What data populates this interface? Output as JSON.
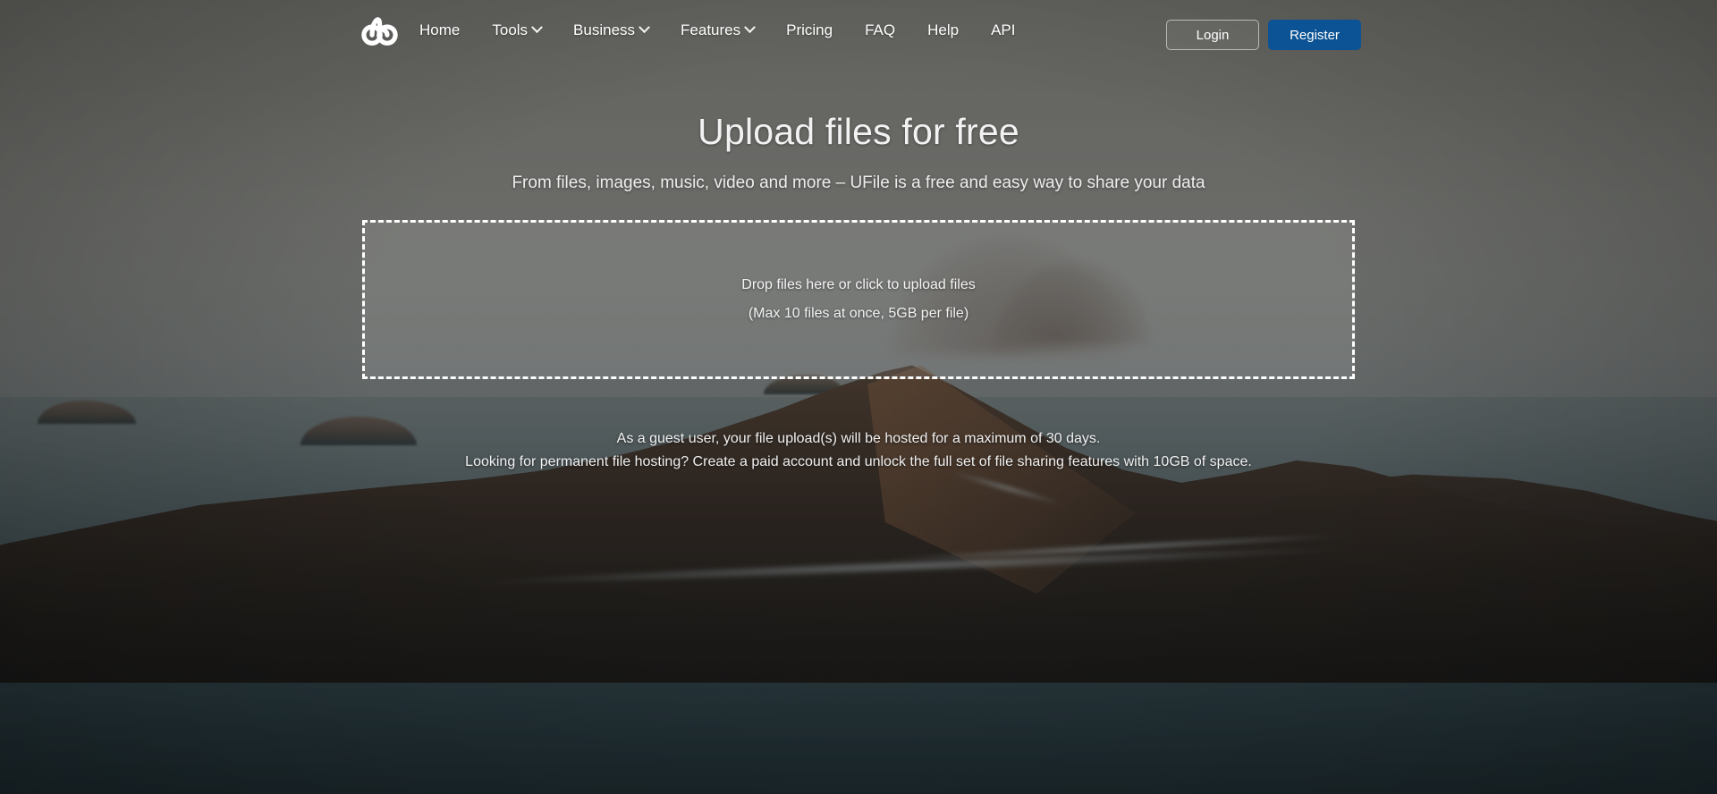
{
  "brand": {
    "logo_icon": "ufile-trefoil-logo-icon",
    "name": "UFile"
  },
  "nav": {
    "items": [
      {
        "label": "Home",
        "has_dropdown": false
      },
      {
        "label": "Tools",
        "has_dropdown": true
      },
      {
        "label": "Business",
        "has_dropdown": true
      },
      {
        "label": "Features",
        "has_dropdown": true
      },
      {
        "label": "Pricing",
        "has_dropdown": false
      },
      {
        "label": "FAQ",
        "has_dropdown": false
      },
      {
        "label": "Help",
        "has_dropdown": false
      },
      {
        "label": "API",
        "has_dropdown": false
      }
    ],
    "login_label": "Login",
    "register_label": "Register"
  },
  "hero": {
    "title": "Upload files for free",
    "subtitle": "From files, images, music, video and more – UFile is a free and easy way to share your data"
  },
  "dropzone": {
    "primary_text": "Drop files here or click to upload files",
    "secondary_text": "(Max 10 files at once, 5GB per file)"
  },
  "notes": {
    "line1": "As a guest user, your file upload(s) will be hosted for a maximum of 30 days.",
    "line2": "Looking for permanent file hosting? Create a paid account and unlock the full set of file sharing features with 10GB of space."
  },
  "colors": {
    "register_button": "#0b5394",
    "dropzone_border": "#ffffff",
    "text_primary": "#ffffff",
    "overlay_tint": "#1e201e"
  }
}
